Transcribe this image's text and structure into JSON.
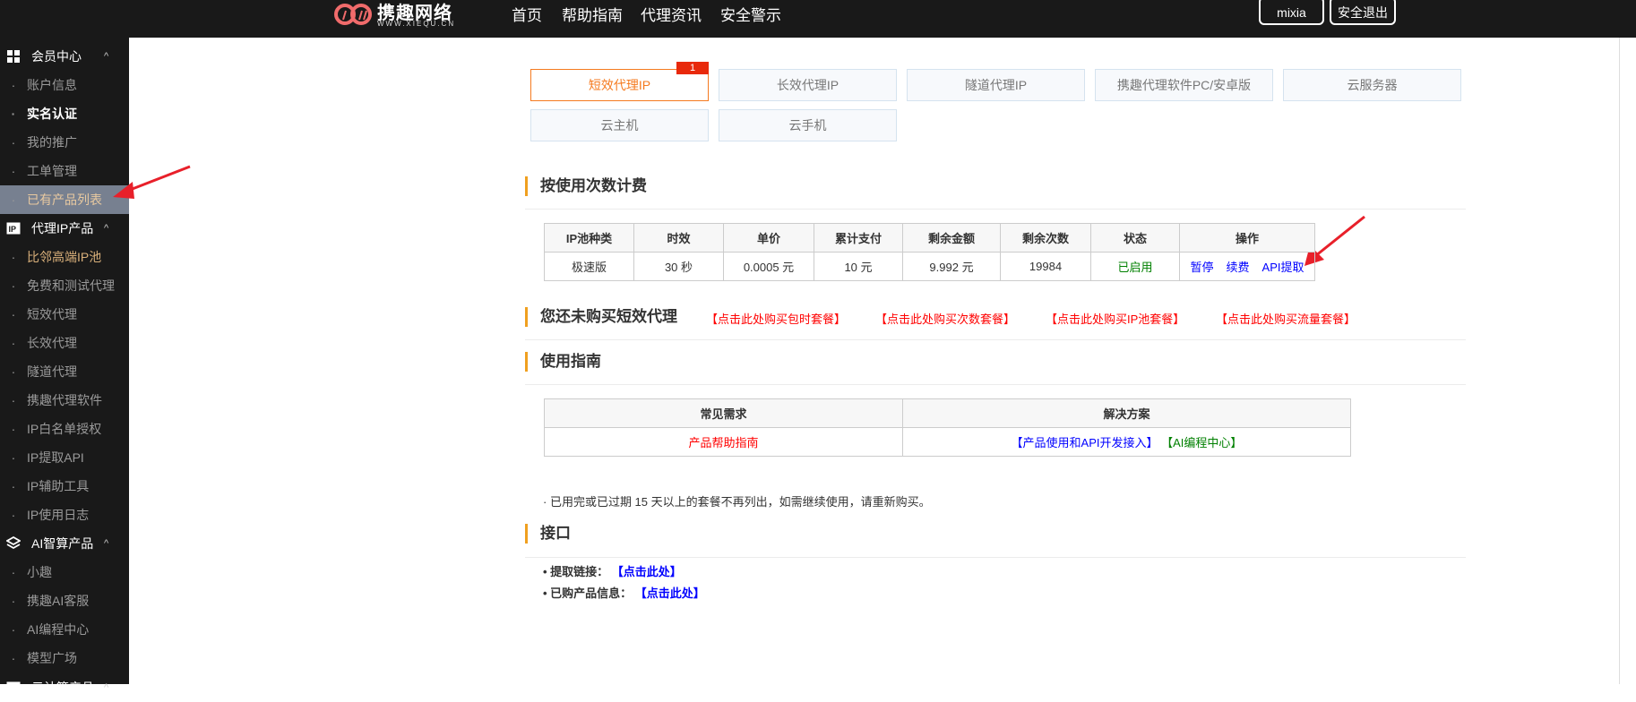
{
  "header": {
    "logo_text": "携趣网络",
    "logo_sub": "WWW.XIEQU.CN",
    "nav": [
      "首页",
      "帮助指南",
      "代理资讯",
      "安全警示"
    ],
    "user": "mixia",
    "logout": "安全退出"
  },
  "sidebar": {
    "groups": [
      {
        "label": "会员中心",
        "items": [
          "账户信息",
          "实名认证",
          "我的推广",
          "工单管理",
          "已有产品列表"
        ]
      },
      {
        "label": "代理IP产品",
        "items": [
          "比邻高端IP池",
          "免费和测试代理",
          "短效代理",
          "长效代理",
          "隧道代理",
          "携趣代理软件",
          "IP白名单授权",
          "IP提取API",
          "IP辅助工具",
          "IP使用日志"
        ]
      },
      {
        "label": "AI智算产品",
        "items": [
          "小趣",
          "携趣AI客服",
          "AI编程中心",
          "模型广场"
        ]
      },
      {
        "label": "云计算产品"
      }
    ]
  },
  "tabs": [
    {
      "label": "短效代理IP",
      "badge": "1"
    },
    {
      "label": "长效代理IP"
    },
    {
      "label": "隧道代理IP"
    },
    {
      "label": "携趣代理软件PC/安卓版"
    },
    {
      "label": "云服务器"
    },
    {
      "label": "云主机"
    },
    {
      "label": "云手机"
    }
  ],
  "billing": {
    "title": "按使用次数计费",
    "headers": [
      "IP池种类",
      "时效",
      "单价",
      "累计支付",
      "剩余金额",
      "剩余次数",
      "状态",
      "操作"
    ],
    "row": {
      "type": "极速版",
      "duration": "30 秒",
      "price": "0.0005 元",
      "paid": "10 元",
      "balance": "9.992 元",
      "remaining": "19984",
      "status": "已启用",
      "actions": [
        "暂停",
        "续费",
        "API提取"
      ]
    }
  },
  "purchase": {
    "title": "您还未购买短效代理",
    "links": [
      "【点击此处购买包时套餐】",
      "【点击此处购买次数套餐】",
      "【点击此处购买IP池套餐】",
      "【点击此处购买流量套餐】"
    ]
  },
  "guide": {
    "title": "使用指南",
    "headers": [
      "常见需求",
      "解决方案"
    ],
    "need": "产品帮助指南",
    "solution1": "【产品使用和API开发接入】",
    "solution2": "【AI编程中心】"
  },
  "note": "· 已用完或已过期 15 天以上的套餐不再列出，如需继续使用，请重新购买。",
  "api": {
    "title": "接口",
    "items": [
      {
        "label": "• 提取链接：",
        "link": "【点击此处】"
      },
      {
        "label": "• 已购产品信息：",
        "link": "【点击此处】"
      }
    ]
  },
  "colors": {
    "accent": "#f57a1f",
    "sidebar_bg": "#191919",
    "status_green": "#008000",
    "link_blue": "#0000ff",
    "arrow_red": "#e8202a"
  }
}
